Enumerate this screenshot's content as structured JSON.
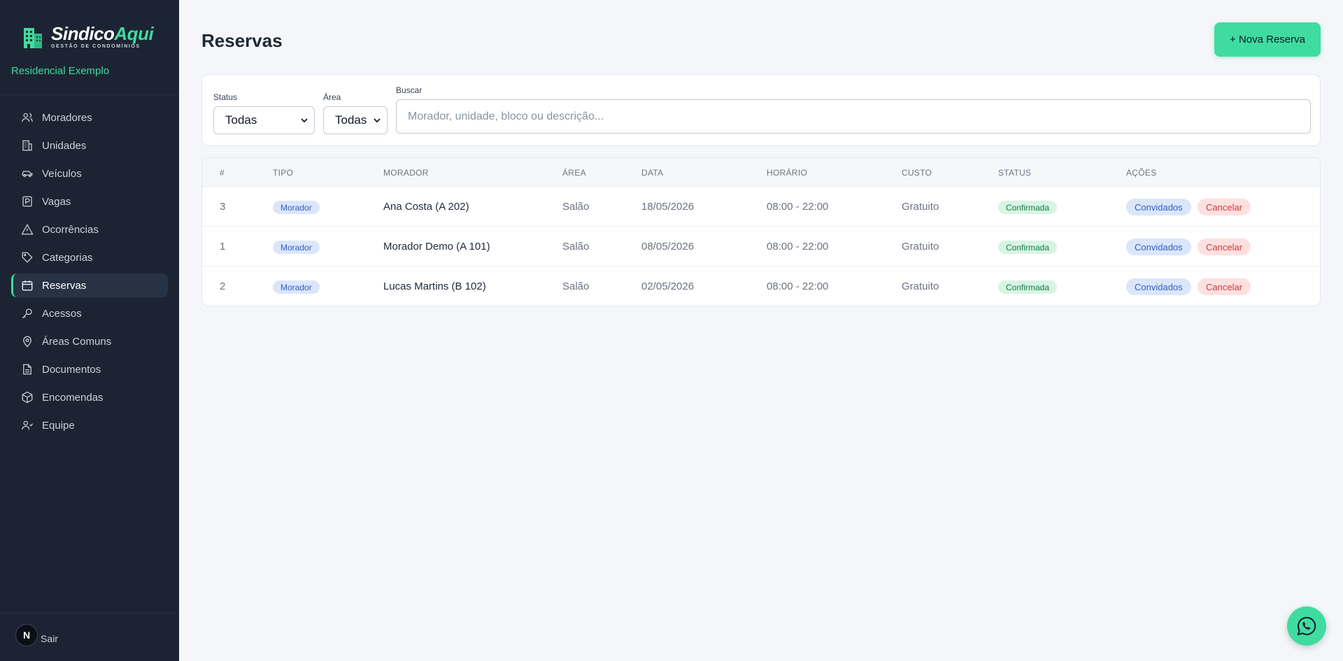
{
  "sidebar": {
    "brand_primary": "Sindico",
    "brand_accent": "Aqui",
    "brand_subtitle": "GESTÃO DE CONDOMÍNIOS",
    "condo_name": "Residencial Exemplo",
    "items": [
      {
        "label": "Moradores",
        "icon": "users-icon",
        "active": false
      },
      {
        "label": "Unidades",
        "icon": "building-icon",
        "active": false
      },
      {
        "label": "Veículos",
        "icon": "car-icon",
        "active": false
      },
      {
        "label": "Vagas",
        "icon": "parking-icon",
        "active": false
      },
      {
        "label": "Ocorrências",
        "icon": "warning-icon",
        "active": false
      },
      {
        "label": "Categorias",
        "icon": "tag-icon",
        "active": false
      },
      {
        "label": "Reservas",
        "icon": "calendar-icon",
        "active": true
      },
      {
        "label": "Acessos",
        "icon": "key-icon",
        "active": false
      },
      {
        "label": "Áreas Comuns",
        "icon": "map-pin-icon",
        "active": false
      },
      {
        "label": "Documentos",
        "icon": "document-icon",
        "active": false
      },
      {
        "label": "Encomendas",
        "icon": "package-icon",
        "active": false
      },
      {
        "label": "Equipe",
        "icon": "team-icon",
        "active": false
      }
    ],
    "avatar_initial": "N",
    "logout_label": "Sair"
  },
  "header": {
    "title": "Reservas",
    "new_button": "+ Nova Reserva"
  },
  "filters": {
    "status_label": "Status",
    "status_value": "Todas",
    "area_label": "Área",
    "area_value": "Todas",
    "search_label": "Buscar",
    "search_placeholder": "Morador, unidade, bloco ou descrição..."
  },
  "table": {
    "columns": [
      "#",
      "TIPO",
      "MORADOR",
      "ÁREA",
      "DATA",
      "HORÁRIO",
      "CUSTO",
      "STATUS",
      "AÇÕES"
    ],
    "rows": [
      {
        "id": "3",
        "tipo": "Morador",
        "morador": "Ana Costa (A 202)",
        "area": "Salão",
        "data": "18/05/2026",
        "horario": "08:00 - 22:00",
        "custo": "Gratuito",
        "status": "Confirmada"
      },
      {
        "id": "1",
        "tipo": "Morador",
        "morador": "Morador Demo (A 101)",
        "area": "Salão",
        "data": "08/05/2026",
        "horario": "08:00 - 22:00",
        "custo": "Gratuito",
        "status": "Confirmada"
      },
      {
        "id": "2",
        "tipo": "Morador",
        "morador": "Lucas Martins (B 102)",
        "area": "Salão",
        "data": "02/05/2026",
        "horario": "08:00 - 22:00",
        "custo": "Gratuito",
        "status": "Confirmada"
      }
    ],
    "action_guests": "Convidados",
    "action_cancel": "Cancelar"
  },
  "colors": {
    "sidebar_bg": "#1c2433",
    "accent": "#3fdc9f",
    "page_bg": "#f4f6f9"
  },
  "floating": {
    "icon": "whatsapp-icon"
  }
}
